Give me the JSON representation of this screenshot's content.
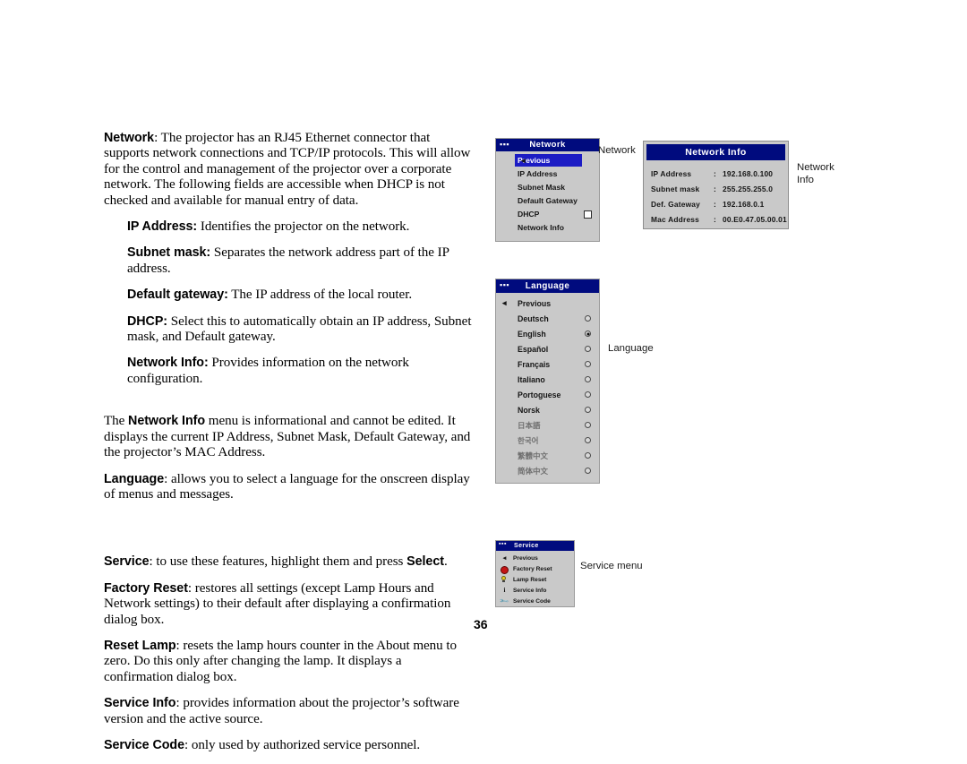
{
  "page": {
    "number": "36"
  },
  "prose": {
    "network_intro": {
      "lead": "Network",
      "text": ": The projector has an RJ45 Ethernet connector that supports network connections and TCP/IP protocols. This will allow for the control and management of the projector over a corporate network. The following fields are accessible when DHCP is not checked and available for manual entry of data."
    },
    "definitions": [
      {
        "lead": "IP Address:",
        "text": " Identifies the projector on the network."
      },
      {
        "lead": "Subnet mask:",
        "text": " Separates the network address part of the IP address."
      },
      {
        "lead": "Default gateway:",
        "text": " The IP address of the local router."
      },
      {
        "lead": "DHCP:",
        "text": " Select this to automatically obtain an IP address, Subnet mask, and Default gateway."
      },
      {
        "lead": "Network Info:",
        "text": " Provides information on the network configuration."
      }
    ],
    "network_info_para": {
      "pre": "The ",
      "lead": "Network Info",
      "text": " menu is informational and cannot be edited. It displays the current IP Address, Subnet Mask, Default Gateway, and the projector’s MAC Address."
    },
    "language_para": {
      "lead": "Language",
      "text": ": allows you to select a language for the onscreen display of menus and messages."
    },
    "service_para": {
      "lead": "Service",
      "text": ": to use these features, highlight them and press ",
      "lead2": "Select",
      "tail": "."
    },
    "service_items": [
      {
        "lead": "Factory Reset",
        "text": ": restores all settings (except Lamp Hours and Network settings) to their default after displaying a confirmation dialog box."
      },
      {
        "lead": "Reset Lamp",
        "text": ": resets the lamp hours counter in the About menu to zero. Do this only after changing the lamp. It displays a confirmation dialog box."
      },
      {
        "lead": "Service Info",
        "text": ": provides information about the projector’s software version and the active source."
      },
      {
        "lead": "Service Code",
        "text": ": only used by authorized service personnel."
      }
    ]
  },
  "network_menu": {
    "title": "Network",
    "dots": "▪▪▪",
    "items": [
      {
        "label": "Previous",
        "selected": true,
        "icon": "left-triangle-icon"
      },
      {
        "label": "IP Address",
        "selected": false
      },
      {
        "label": "Subnet Mask",
        "selected": false
      },
      {
        "label": "Default Gateway",
        "selected": false
      },
      {
        "label": "DHCP",
        "selected": false,
        "control": "checkbox",
        "checked": false
      },
      {
        "label": "Network Info",
        "selected": false
      }
    ]
  },
  "network_info_dialog": {
    "title": "Network Info",
    "rows": [
      {
        "label": "IP Address",
        "colon": ":",
        "value": "192.168.0.100"
      },
      {
        "label": "Subnet mask",
        "colon": ":",
        "value": "255.255.255.0"
      },
      {
        "label": "Def. Gateway",
        "colon": ":",
        "value": "192.168.0.1"
      },
      {
        "label": "Mac Address",
        "colon": ":",
        "value": "00.E0.47.05.00.01"
      }
    ]
  },
  "language_menu": {
    "title": "Language",
    "dots": "▪▪▪",
    "items": [
      {
        "label": "Previous",
        "control": "none",
        "icon": "left-triangle-icon"
      },
      {
        "label": "Deutsch",
        "control": "radio",
        "checked": false
      },
      {
        "label": "English",
        "control": "radio",
        "checked": true
      },
      {
        "label": "Español",
        "control": "radio",
        "checked": false
      },
      {
        "label": "Français",
        "control": "radio",
        "checked": false
      },
      {
        "label": "Italiano",
        "control": "radio",
        "checked": false
      },
      {
        "label": "Portoguese",
        "control": "radio",
        "checked": false
      },
      {
        "label": "Norsk",
        "control": "radio",
        "checked": false
      },
      {
        "label": "日本語",
        "control": "radio",
        "checked": false,
        "cjk": true
      },
      {
        "label": "한국어",
        "control": "radio",
        "checked": false,
        "cjk": true
      },
      {
        "label": "繁體中文",
        "control": "radio",
        "checked": false,
        "cjk": true
      },
      {
        "label": "简体中文",
        "control": "radio",
        "checked": false,
        "cjk": true
      }
    ]
  },
  "service_menu": {
    "title": "Service",
    "dots": "▪▪▪",
    "items": [
      {
        "label": "Previous",
        "icon": "left-triangle-icon"
      },
      {
        "label": "Factory Reset",
        "icon": "red-circle-icon"
      },
      {
        "label": "Lamp Reset",
        "icon": "lamp-icon"
      },
      {
        "label": "Service Info",
        "icon": "info-icon"
      },
      {
        "label": "Service Code",
        "icon": "wrench-icon"
      }
    ]
  },
  "callouts": {
    "network": "Network",
    "network_info": "Network Info",
    "language": "Language",
    "service": "Service menu"
  },
  "colors": {
    "title_bar": "#000b7e",
    "menu_background": "#c9c9c9",
    "highlight": "#1c1cc4",
    "factory_reset_icon": "#c41414",
    "lamp_icon": "#e8d22a"
  }
}
